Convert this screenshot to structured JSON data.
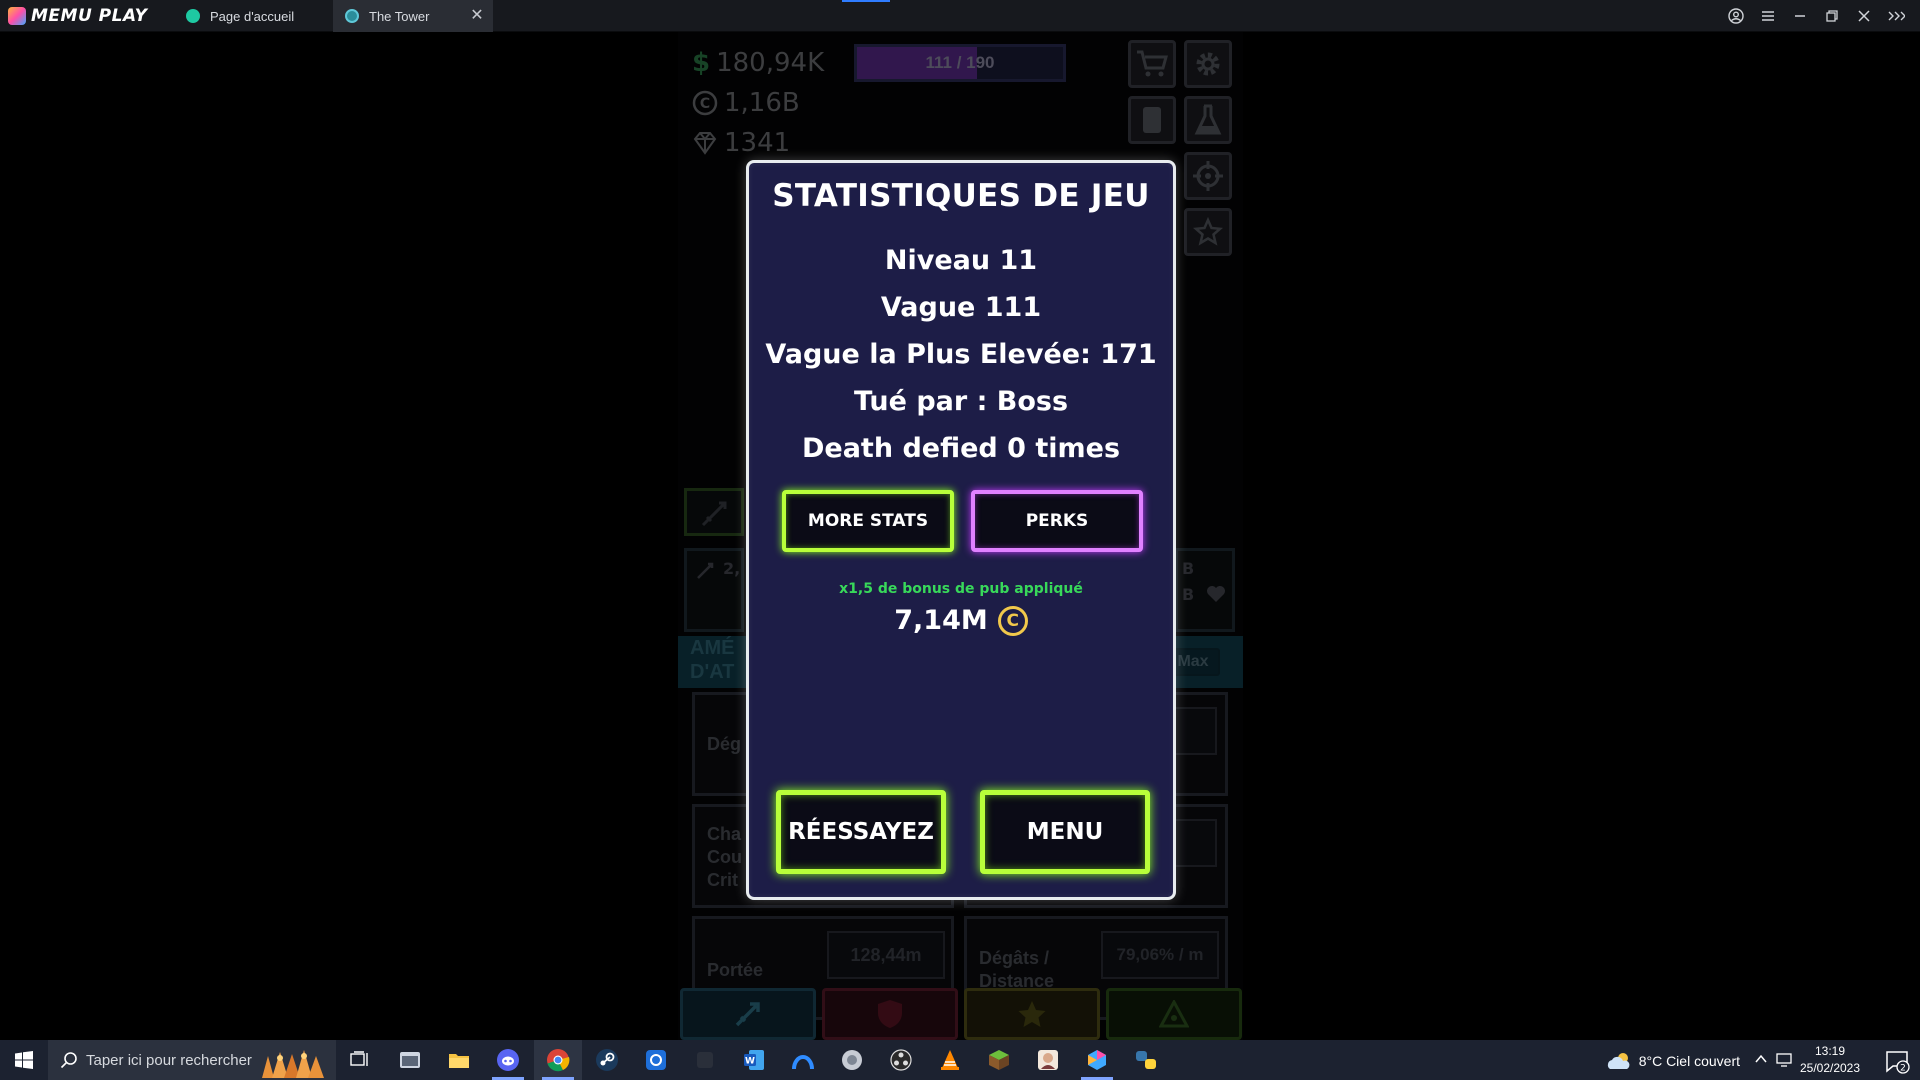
{
  "emulator": {
    "brand": "MEMU PLAY",
    "tabs": [
      {
        "label": "Page d'accueil",
        "active": false
      },
      {
        "label": "The Tower",
        "active": true
      }
    ]
  },
  "game": {
    "cash": "180,94K",
    "coins": "1,16B",
    "gems": "1341",
    "wave_progress": {
      "label": "111 / 190",
      "current": 111,
      "max": 190
    },
    "upgrade_banner_title_1": "AMÉ",
    "upgrade_banner_title_2": "D'AT",
    "max_label": "Max",
    "cards": {
      "damage_label": "Dég",
      "crit_label_1": "Cha",
      "crit_label_2": "Cou",
      "crit_label_3": "Crit",
      "crit_value_partial": "B",
      "range_label": "Portée",
      "range_value": "128,44m",
      "dmg_dist_label_1": "Dégâts /",
      "dmg_dist_label_2": "Distance",
      "dmg_dist_value": "79,06% / m"
    },
    "left_stat_partial": "2,",
    "right_stat_partial_1": "B",
    "right_stat_partial_2": "B"
  },
  "modal": {
    "title": "STATISTIQUES DE JEU",
    "level": "Niveau 11",
    "wave": "Vague 111",
    "highest_wave": "Vague la Plus Elevée: 171",
    "killed_by": "Tué par : Boss",
    "death_defied": "Death defied 0 times",
    "more_stats_label": "MORE STATS",
    "perks_label": "PERKS",
    "ad_bonus": "x1,5 de bonus de pub appliqué",
    "reward": "7,14M",
    "retry_label": "RÉESSAYEZ",
    "menu_label": "MENU"
  },
  "taskbar": {
    "search_placeholder": "Taper ici pour rechercher",
    "weather": "8°C  Ciel couvert",
    "time": "13:19",
    "date": "25/02/2023",
    "notifications": "2"
  },
  "colors": {
    "modal_bg": "#1d1d47",
    "neon_green": "#b8ff3a",
    "neon_purple": "#e081ff",
    "bonus_green": "#38d85a",
    "coin_gold": "#f1c84b"
  }
}
